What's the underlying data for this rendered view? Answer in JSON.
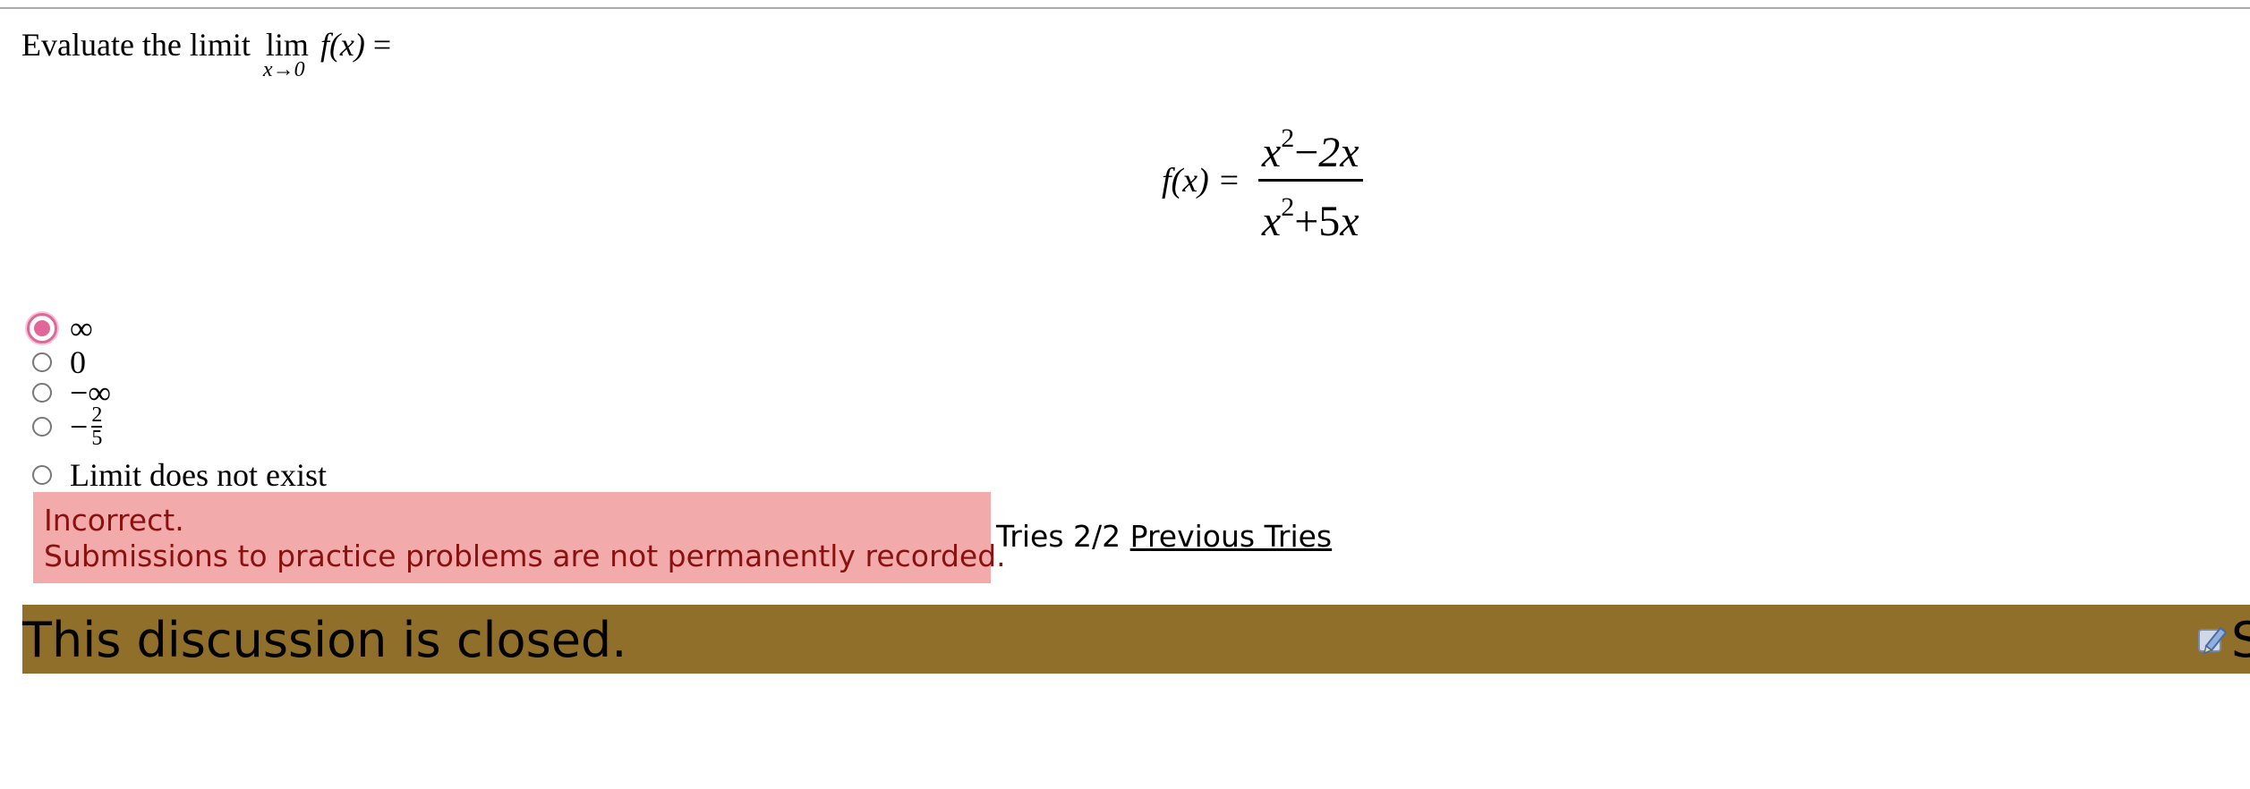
{
  "question": {
    "prompt": "Evaluate the limit",
    "lim": "lim",
    "lim_sub": "x→0",
    "fx": "f(x)",
    "equals": "="
  },
  "equation": {
    "lhs": "f(x) =",
    "num_var": "x",
    "num_exp": "2",
    "num_rest": "−2x",
    "den_var": "x",
    "den_exp": "2",
    "den_rest": "+5x"
  },
  "choices": [
    {
      "label": "∞",
      "selected": true
    },
    {
      "label": "0",
      "selected": false
    },
    {
      "label": "−∞",
      "selected": false
    },
    {
      "label_sign": "−",
      "label_num": "2",
      "label_den": "5",
      "selected": false
    },
    {
      "label": "Limit does not exist",
      "selected": false
    }
  ],
  "feedback": {
    "line1": "Incorrect.",
    "line2": "Submissions to practice problems are not permanently recorded."
  },
  "tries": {
    "text": "Tries 2/2",
    "link": "Previous Tries"
  },
  "discussion": {
    "message": "This discussion is closed.",
    "icon": "edit-icon",
    "clipped_label": "S"
  },
  "colors": {
    "feedback_bg": "#f3aaaa",
    "feedback_text": "#8b1111",
    "discussion_bg": "#8f6f2a",
    "radio_selected": "#e0679a"
  }
}
